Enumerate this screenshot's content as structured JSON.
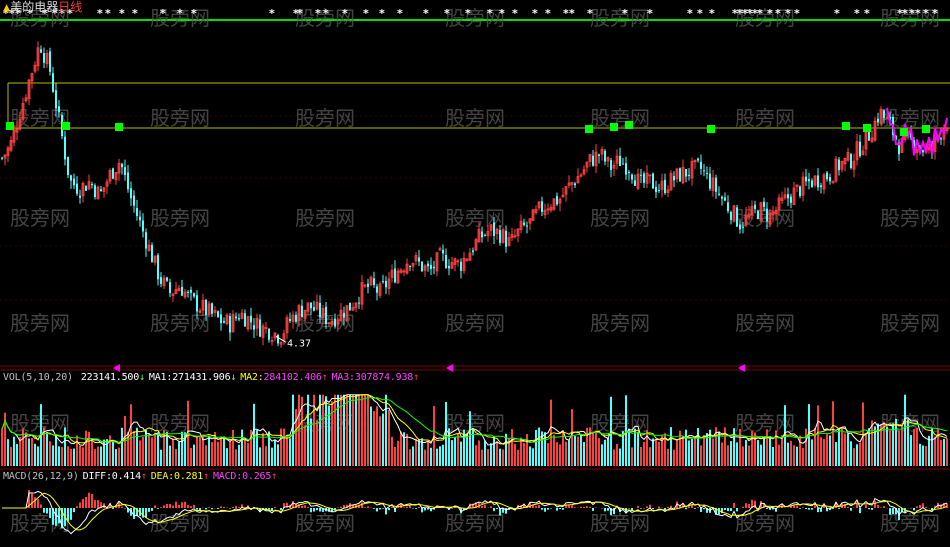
{
  "title": {
    "stock_name": "美的电器",
    "period": "日线",
    "prefix_icon": "signal-icon"
  },
  "price_panel": {
    "low_label": "4.37",
    "watermark": "股旁网",
    "level_lines": [
      {
        "name": "top-green",
        "color": "#00e000"
      },
      {
        "name": "upper-yellow",
        "color": "#b8b800"
      },
      {
        "name": "lower-yellow",
        "color": "#b8b800"
      }
    ]
  },
  "vol_panel": {
    "name": "VOL(5,10,20)",
    "value": "223141.500",
    "value_arrow": "↓",
    "ma1_label": "MA1:",
    "ma1_value": "271431.906",
    "ma1_arrow": "↓",
    "ma2_label": "MA2:",
    "ma2_value": "284102.406",
    "ma2_arrow": "↑",
    "ma3_label": "MA3:",
    "ma3_value": "307874.938",
    "ma3_arrow": "↑"
  },
  "macd_panel": {
    "name": "MACD(26,12,9)",
    "diff_label": "DIFF:",
    "diff_value": "0.414",
    "diff_arrow": "↑",
    "dea_label": "DEA:",
    "dea_value": "0.281",
    "dea_arrow": "↑",
    "macd_label": "MACD:",
    "macd_value": "0.265",
    "macd_arrow": "↑"
  },
  "colors": {
    "up": "#ff4040",
    "down": "#54ffff",
    "ma1": "#ffffff",
    "ma2": "#ffff00",
    "ma3": "#ff00ff",
    "ma_green": "#00ff00",
    "grid": "#800000",
    "text_white": "#ffffff",
    "text_yellow": "#ffff00",
    "text_magenta": "#ff40ff",
    "arrow_up": "#ff4040",
    "arrow_down": "#54ff54"
  },
  "chart_data": {
    "type": "candlestick",
    "price_path": {
      "x": [
        0,
        10,
        20,
        30,
        40,
        50,
        60,
        70,
        80,
        90,
        100,
        110,
        120,
        130,
        140,
        150,
        160,
        170,
        180,
        190,
        200,
        210,
        220,
        230,
        240,
        250,
        260,
        270,
        280,
        290,
        300,
        310,
        320,
        330,
        340,
        350,
        360,
        370,
        380,
        390,
        400,
        410,
        420,
        430,
        440,
        450,
        460,
        470,
        480,
        490,
        500,
        510,
        520,
        530,
        540,
        550,
        560,
        570,
        580,
        590,
        600,
        610,
        620,
        630,
        640,
        650,
        660,
        670,
        680,
        690,
        700,
        710,
        720,
        730,
        740,
        750,
        760,
        770,
        780,
        790,
        800,
        810,
        820,
        830,
        840,
        850,
        860,
        870,
        880,
        890,
        900,
        910,
        920,
        930,
        940,
        948
      ],
      "close": [
        6.9,
        7.1,
        7.6,
        8.1,
        8.6,
        8.2,
        7.4,
        6.6,
        6.5,
        6.6,
        6.4,
        6.7,
        6.9,
        6.4,
        6.0,
        5.6,
        5.2,
        5.0,
        5.1,
        4.9,
        4.8,
        4.7,
        4.6,
        4.55,
        4.7,
        4.6,
        4.5,
        4.45,
        4.37,
        4.6,
        4.75,
        4.8,
        4.7,
        4.6,
        4.7,
        4.8,
        5.0,
        5.1,
        5.0,
        5.2,
        5.35,
        5.5,
        5.4,
        5.3,
        5.5,
        5.45,
        5.4,
        5.6,
        5.8,
        5.9,
        5.85,
        5.7,
        5.9,
        6.0,
        6.2,
        6.3,
        6.35,
        6.55,
        6.7,
        6.9,
        7.0,
        6.8,
        6.9,
        6.8,
        6.55,
        6.6,
        6.5,
        6.6,
        6.7,
        6.75,
        6.8,
        6.6,
        6.4,
        6.2,
        6.0,
        6.1,
        6.2,
        6.1,
        6.25,
        6.4,
        6.5,
        6.6,
        6.65,
        6.7,
        6.85,
        6.9,
        7.1,
        7.3,
        7.6,
        7.4,
        7.1,
        7.2,
        7.1,
        7.0,
        7.3,
        7.5
      ]
    },
    "series": [
      {
        "name": "VOL",
        "value": 223141.5
      },
      {
        "name": "MA1",
        "value": 271431.906
      },
      {
        "name": "MA2",
        "value": 284102.406
      },
      {
        "name": "MA3",
        "value": 307874.938
      },
      {
        "name": "DIFF",
        "value": 0.414
      },
      {
        "name": "DEA",
        "value": 0.281
      },
      {
        "name": "MACD",
        "value": 0.265
      }
    ],
    "annotations": [
      "4.37"
    ]
  }
}
